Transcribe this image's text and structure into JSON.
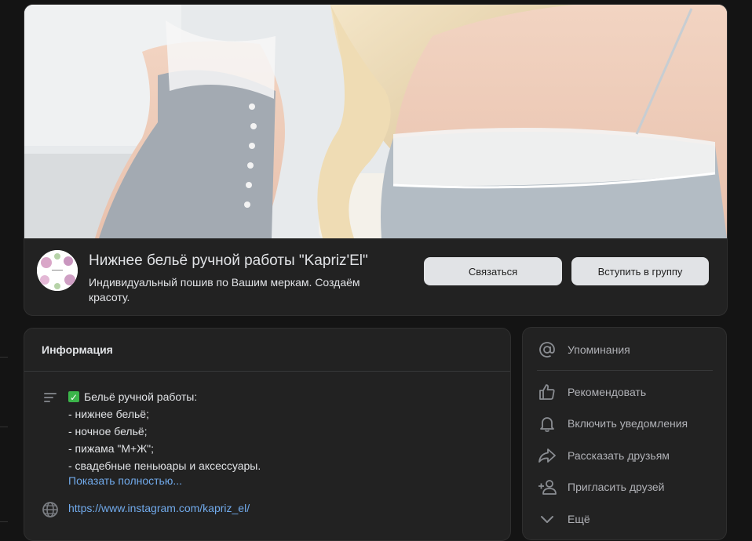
{
  "group": {
    "title": "Нижнее бельё ручной работы \"Kapriz'El\"",
    "description": "Индивидуальный пошив по Вашим меркам. Создаём красоту.",
    "contact_label": "Связаться",
    "join_label": "Вступить в группу"
  },
  "info": {
    "title": "Информация",
    "description_lines": [
      "Бельё ручной работы:",
      "- нижнее бельё;",
      "- ночное бельё;",
      "- пижама \"М+Ж\";",
      "- свадебные пеньюары и аксессуары."
    ],
    "show_more": "Показать полностью...",
    "website": "https://www.instagram.com/kapriz_el/"
  },
  "actions": [
    {
      "label": "Упоминания",
      "icon": "at-icon"
    },
    {
      "label": "Рекомендовать",
      "icon": "thumbs-up-icon"
    },
    {
      "label": "Включить уведомления",
      "icon": "bell-icon"
    },
    {
      "label": "Рассказать друзьям",
      "icon": "share-icon"
    },
    {
      "label": "Пригласить друзей",
      "icon": "add-user-icon"
    },
    {
      "label": "Ещё",
      "icon": "chevron-down-icon"
    }
  ],
  "colors": {
    "background": "#141414",
    "card": "#222222",
    "link": "#71aaeb",
    "button": "#e1e3e6"
  }
}
